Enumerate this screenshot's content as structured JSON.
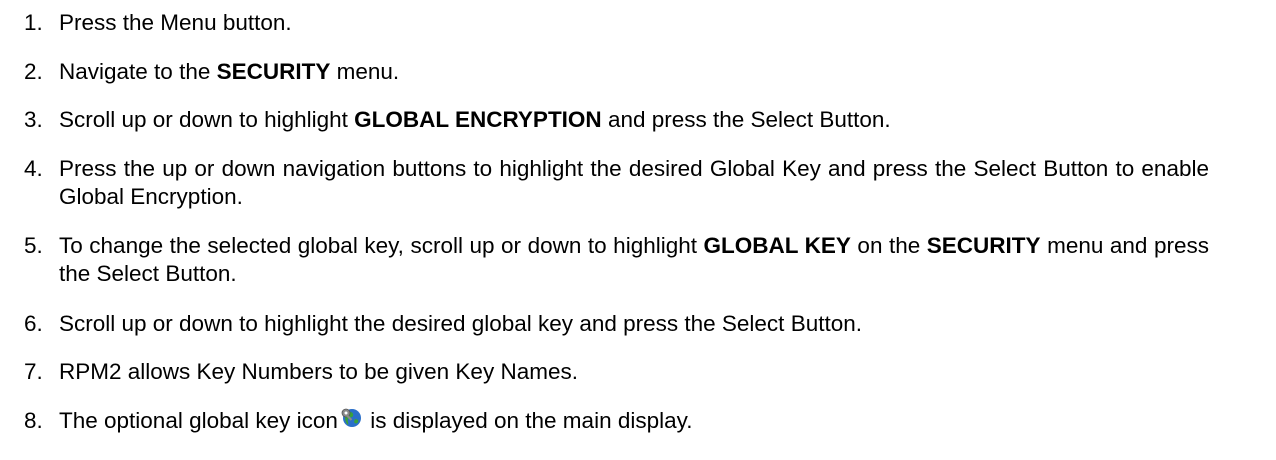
{
  "steps": [
    {
      "num": "1.",
      "text": "Press the Menu button."
    },
    {
      "num": "2.",
      "pre": "Navigate to the ",
      "bold": "SECURITY",
      "post": " menu."
    },
    {
      "num": "3.",
      "pre": "Scroll up or down to highlight ",
      "bold": "GLOBAL ENCRYPTION",
      "post": " and press the Select Button."
    },
    {
      "num": "4.",
      "text": "Press the up or down navigation buttons to highlight the desired Global Key and press the Select Button to enable Global Encryption."
    },
    {
      "num": "5.",
      "pre": "To change the selected global key, scroll up or down to highlight ",
      "bold": "GLOBAL KEY",
      "mid": " on the ",
      "bold2": "SECURITY",
      "post": " menu and press the Select Button."
    },
    {
      "num": "6.",
      "text": "Scroll up or down to highlight the desired global key and press the Select Button."
    },
    {
      "num": "7.",
      "text": "RPM2 allows Key Numbers to be given Key Names."
    },
    {
      "num": "8.",
      "pre": "The optional global key icon",
      "icon": "globe-key-icon",
      "post": " is displayed on the main display."
    }
  ],
  "colors": {
    "text": "#000000",
    "background": "#ffffff",
    "globe_blue": "#2a6fc9",
    "globe_green": "#3aa23a",
    "key_gray": "#8a8a8a"
  }
}
